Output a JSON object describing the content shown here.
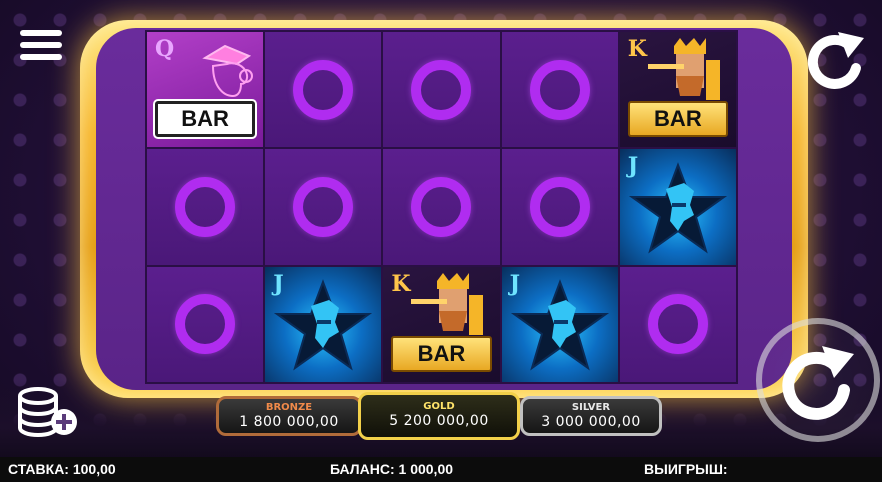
{
  "reels": [
    [
      "queen-bar",
      "ring",
      "ring",
      "ring",
      "king-bar"
    ],
    [
      "ring",
      "ring",
      "ring",
      "ring",
      "jack-star"
    ],
    [
      "ring",
      "jack-star",
      "king-bar",
      "jack-star",
      "ring"
    ]
  ],
  "symbols": {
    "queen_letter": "Q",
    "king_letter": "K",
    "jack_letter": "J",
    "bar_label": "BAR"
  },
  "jackpots": {
    "bronze": {
      "name": "BRONZE",
      "value": "1 800 000,00"
    },
    "gold": {
      "name": "GOLD",
      "value": "5 200 000,00"
    },
    "silver": {
      "name": "SILVER",
      "value": "3 000 000,00"
    }
  },
  "status": {
    "bet": "СТАВКА: 100,00",
    "balance": "БАЛАНС: 1 000,00",
    "win": "ВЫИГРЫШ:"
  },
  "colors": {
    "frame_gold": "#f6b42a",
    "cell_purple": "#5b1f8e",
    "ring_magenta": "#b02cf0",
    "jack_blue": "#2bc6ff"
  },
  "icons": {
    "menu": "hamburger-icon",
    "reload": "refresh-icon",
    "spin": "spin-icon",
    "coins": "coins-plus-icon"
  }
}
